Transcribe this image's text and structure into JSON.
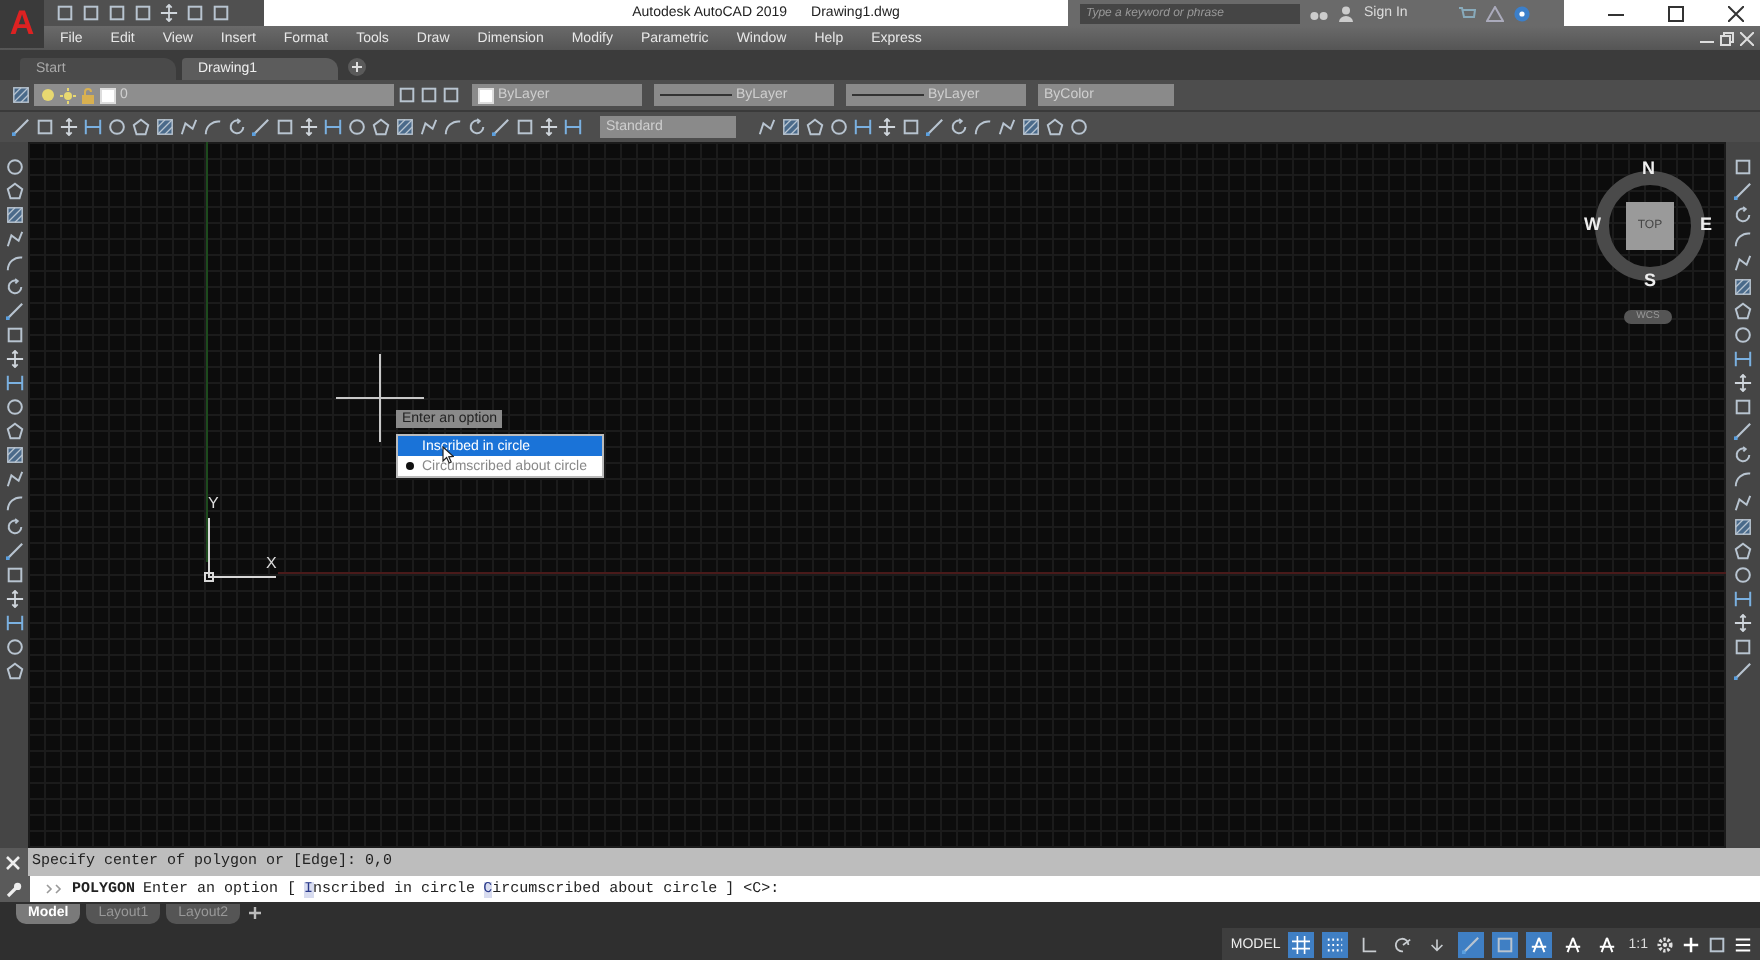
{
  "title_bar": {
    "logo": "A",
    "app_title": "Autodesk AutoCAD 2019",
    "file_name": "Drawing1.dwg",
    "search": {
      "placeholder": "Type a keyword or phrase"
    },
    "sign_in": "Sign In"
  },
  "menu_bar": [
    "File",
    "Edit",
    "View",
    "Insert",
    "Format",
    "Tools",
    "Draw",
    "Dimension",
    "Modify",
    "Parametric",
    "Window",
    "Help",
    "Express"
  ],
  "file_tabs": [
    {
      "label": "Start",
      "selected": false
    },
    {
      "label": "Drawing1",
      "selected": true
    }
  ],
  "layer_toolbar": {
    "layer": "0",
    "color_setting": "ByLayer",
    "linetype": "ByLayer",
    "lineweight": "ByLayer",
    "plot_style": "ByColor"
  },
  "dimension_toolbar": {
    "dim_style": "Standard"
  },
  "viewcube": {
    "north": "N",
    "south": "S",
    "east": "E",
    "west": "W",
    "face": "TOP",
    "coordinate_system": "WCS"
  },
  "ucs": {
    "x": "X",
    "y": "Y"
  },
  "prompt": {
    "title": "Enter an option",
    "options": [
      {
        "label": "Inscribed in circle",
        "selected": true,
        "default": false
      },
      {
        "label": "Circumscribed about circle",
        "selected": false,
        "default": true
      }
    ]
  },
  "command_history": "Specify center of polygon or [Edge]: 0,0",
  "command_line": {
    "command": "POLYGON",
    "prompt": "Enter an option [",
    "options": [
      "Inscribed in circle",
      "Circumscribed about circle"
    ],
    "suffix": "] <C>:"
  },
  "layout_tabs": [
    {
      "label": "Model",
      "selected": true
    },
    {
      "label": "Layout1",
      "selected": false
    },
    {
      "label": "Layout2",
      "selected": false
    }
  ],
  "status_bar": {
    "space": "MODEL",
    "scale": "1:1",
    "toggles": [
      {
        "kind": "grid",
        "on": true
      },
      {
        "kind": "snap",
        "on": true
      },
      {
        "kind": "ortho",
        "on": false
      },
      {
        "kind": "polar",
        "on": false
      },
      {
        "kind": "isodraft",
        "on": false
      },
      {
        "kind": "otrack",
        "on": true
      },
      {
        "kind": "osnap",
        "on": true
      },
      {
        "kind": "annotation",
        "on": true
      },
      {
        "kind": "autoscale",
        "on": false
      },
      {
        "kind": "annoscale",
        "on": false
      }
    ]
  }
}
